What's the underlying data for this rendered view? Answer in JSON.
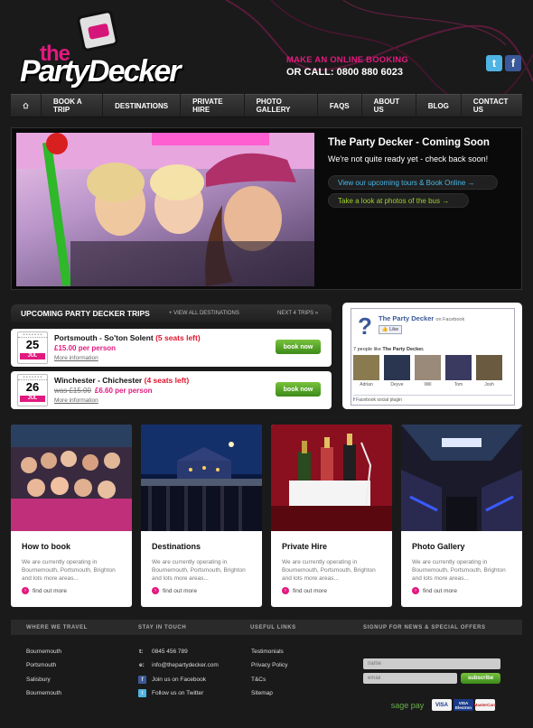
{
  "header": {
    "brand_small": "the",
    "brand_name": "PartyDecker",
    "booking_line1": "MAKE AN ONLINE BOOKING",
    "booking_line2": "OR CALL: 0800 880 6023",
    "twitter_glyph": "t",
    "facebook_glyph": "f"
  },
  "nav": {
    "home_icon": "home-icon",
    "items": [
      "BOOK A TRIP",
      "DESTINATIONS",
      "PRIVATE HIRE",
      "PHOTO GALLERY",
      "FAQS",
      "ABOUT US",
      "BLOG",
      "CONTACT US"
    ]
  },
  "hero": {
    "title": "The Party Decker - Coming Soon",
    "subtitle": "We're not quite ready yet - check back soon!",
    "link1": "View our upcoming tours & Book Online  →",
    "link2": "Take a look at photos of the bus  →"
  },
  "trips": {
    "heading": "UPCOMING PARTY DECKER TRIPS",
    "view_all": "+  VIEW ALL DESTINATIONS",
    "next": "NEXT 4 TRIPS  »",
    "items": [
      {
        "day": "25",
        "month": "JUL",
        "route": "Portsmouth - So'ton Solent",
        "seats": "(5 seats left)",
        "old_price": "",
        "price": "£15.00 per person",
        "more": "More information",
        "button": "book now"
      },
      {
        "day": "26",
        "month": "JUL",
        "route": "Winchester - Chichester",
        "seats": "(4 seats left)",
        "old_price": "was £15.00",
        "price": "£6.60 per person",
        "more": "More information",
        "button": "book now"
      }
    ]
  },
  "facebook": {
    "page_name": "The Party Decker",
    "on_facebook": "on Facebook",
    "like_button": "Like",
    "count_prefix": "7 people like ",
    "count_name": "The Party Decker.",
    "fans": [
      "Adrian",
      "Deyve",
      "Will",
      "Tom",
      "Josh"
    ],
    "plugin_label": "Facebook social plugin"
  },
  "cards": [
    {
      "title": "How to book",
      "text": "We are currently operating in Bournemouth, Portsmouth, Brighton and lots more areas...",
      "link": "find out more"
    },
    {
      "title": "Destinations",
      "text": "We are currently operating in Bournemouth, Portsmouth, Brighton and lots more areas...",
      "link": "find out more"
    },
    {
      "title": "Private Hire",
      "text": "We are currently operating in Bournemouth, Portsmouth, Brighton and lots more areas...",
      "link": "find out more"
    },
    {
      "title": "Photo Gallery",
      "text": "We are currently operating in Bournemouth, Portsmouth, Brighton and lots more areas...",
      "link": "find out more"
    }
  ],
  "footer": {
    "col1_title": "WHERE WE TRAVEL",
    "col2_title": "STAY IN TOUCH",
    "col3_title": "USEFUL LINKS",
    "col4_title": "SIGNUP FOR NEWS & SPECIAL OFFERS",
    "places": [
      "Bournemouth",
      "Portsmouth",
      "Salisbury",
      "Bournemouth"
    ],
    "contact": [
      {
        "icon": "t:",
        "text": "0845 456 789"
      },
      {
        "icon": "e:",
        "text": "info@thepartydecker.com"
      },
      {
        "icon": "f",
        "text": "Join us on Facebook"
      },
      {
        "icon": "t",
        "text": "Follow us on Twitter"
      }
    ],
    "links": [
      "Testimonials",
      "Privacy Policy",
      "T&Cs",
      "Sitemap"
    ],
    "name_placeholder": "name",
    "email_placeholder": "email",
    "subscribe": "subscribe",
    "sagepay": "sage pay",
    "visa": "VISA",
    "visa_electron": "VISA Electron",
    "mastercard": "MasterCard"
  },
  "colors": {
    "accent": "#e2197f",
    "green": "#5aa62a",
    "blue": "#4ab8e8",
    "lime": "#9ed12b"
  }
}
